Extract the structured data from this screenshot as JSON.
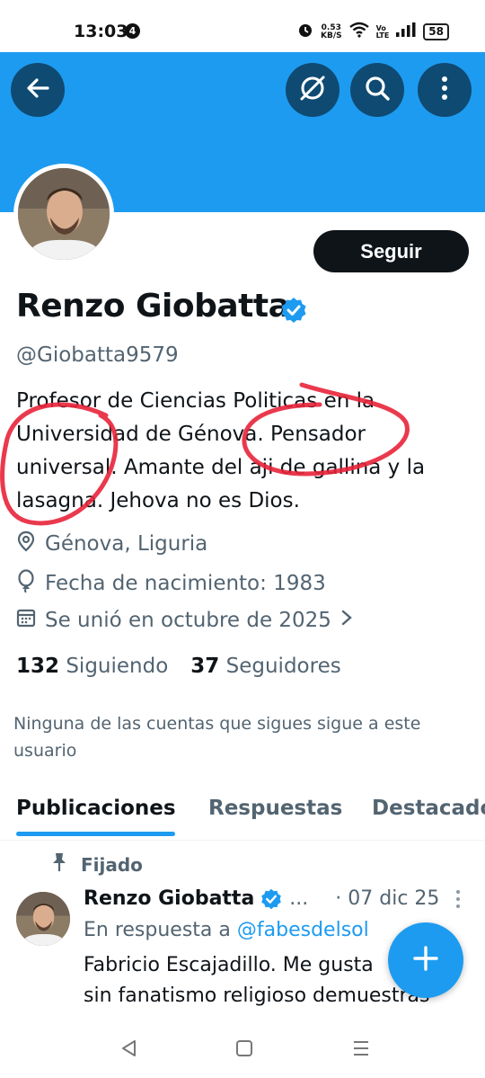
{
  "status_bar": {
    "time": "13:03",
    "notification_count": "4",
    "net_speed_value": "0.53",
    "net_speed_unit": "KB/S",
    "volte_top": "Vo",
    "volte_bottom": "LTE",
    "battery": "58"
  },
  "header": {
    "banner_color": "#1d9bf0",
    "back_icon": "arrow-left-icon",
    "grok_icon": "grok-icon",
    "search_icon": "search-icon",
    "more_icon": "more-vertical-icon"
  },
  "profile": {
    "name": "Renzo Giobatta",
    "handle": "@Giobatta9579",
    "follow_label": "Seguir",
    "bio_lines": [
      "Profesor de Ciencias Politicas en la",
      "Universidad de Génova. Pensador",
      "universal. Amante del aji de gallina y la",
      "lasagna. Jehova no es Dios."
    ],
    "location": "Génova, Liguria",
    "birth": "Fecha de nacimiento: 1983",
    "joined": "Se unió en octubre de 2025",
    "following_count": "132",
    "following_label": "Siguiendo",
    "followers_count": "37",
    "followers_label": "Seguidores",
    "mutual_notice": "Ninguna de las cuentas que sigues sigue a este usuario"
  },
  "tabs": [
    "Publicaciones",
    "Respuestas",
    "Destacado"
  ],
  "pinned_post": {
    "pinned_label": "Fijado",
    "author": "Renzo Giobatta",
    "ellipsis": "...",
    "date": "· 07 dic 25",
    "reply_prefix": "En respuesta a",
    "reply_handle": "@fabesdelsol",
    "text_lines": [
      "Fabricio Escajadillo. Me gusta",
      "sin fanatismo religioso demuestras"
    ]
  },
  "colors": {
    "accent": "#1d9bf0",
    "dark_button": "#0f1419",
    "header_button": "#0f4a72",
    "annotation_red": "#e8243a"
  }
}
